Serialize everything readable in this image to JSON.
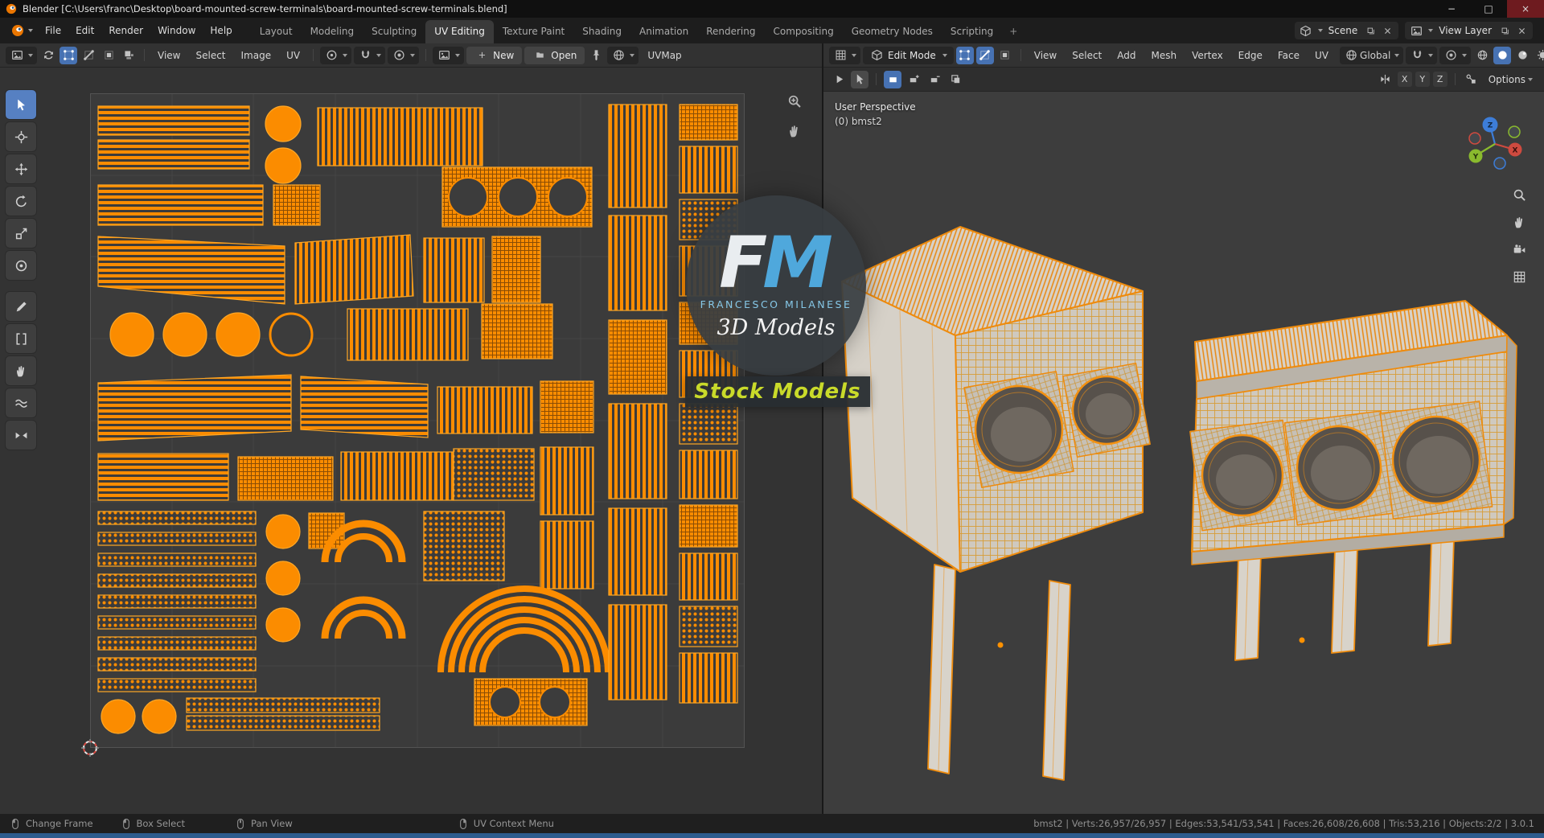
{
  "window": {
    "title": "Blender [C:\\Users\\franc\\Desktop\\board-mounted-screw-terminals\\board-mounted-screw-terminals.blend]",
    "minimize": "−",
    "maximize": "□",
    "close": "×"
  },
  "menubar": {
    "menus": [
      "File",
      "Edit",
      "Render",
      "Window",
      "Help"
    ],
    "workspaces": [
      "Layout",
      "Modeling",
      "Sculpting",
      "UV Editing",
      "Texture Paint",
      "Shading",
      "Animation",
      "Rendering",
      "Compositing",
      "Geometry Nodes",
      "Scripting"
    ],
    "active_workspace": "UV Editing",
    "add_tab": "+",
    "scene_name": "Scene",
    "view_layer_name": "View Layer"
  },
  "uv_editor": {
    "menus": [
      "View",
      "Select",
      "Image",
      "UV"
    ],
    "new_button": "New",
    "open_button": "Open",
    "uv_map": "UVMap"
  },
  "viewport": {
    "mode": "Edit Mode",
    "menus": [
      "View",
      "Select",
      "Add",
      "Mesh",
      "Vertex",
      "Edge",
      "Face",
      "UV"
    ],
    "orientation": "Global",
    "mirror": [
      "X",
      "Y",
      "Z"
    ],
    "options_label": "Options",
    "overlay_line1": "User Perspective",
    "overlay_line2": "(0) bmst2",
    "gizmo": {
      "x": "X",
      "y": "Y",
      "z": "Z"
    }
  },
  "watermark": {
    "initial_f": "F",
    "initial_m": "M",
    "name": "FRANCESCO MILANESE",
    "tagline": "3D Models",
    "banner": "Stock Models"
  },
  "statusbar": {
    "items": [
      "Change Frame",
      "Box Select",
      "Pan View",
      "UV Context Menu"
    ],
    "stats": "bmst2 | Verts:26,957/26,957 | Edges:53,541/53,541 | Faces:26,608/26,608 | Tris:53,216 | Objects:2/2 | 3.0.1"
  },
  "colors": {
    "accent_orange": "#fb8c00",
    "selection_blue": "#4772b3",
    "logo_blue": "#4fa8dc",
    "banner_text": "#c9da2a",
    "axis_x": "#cf4a3f",
    "axis_y": "#8aba2e",
    "axis_z": "#3d7dd8"
  }
}
